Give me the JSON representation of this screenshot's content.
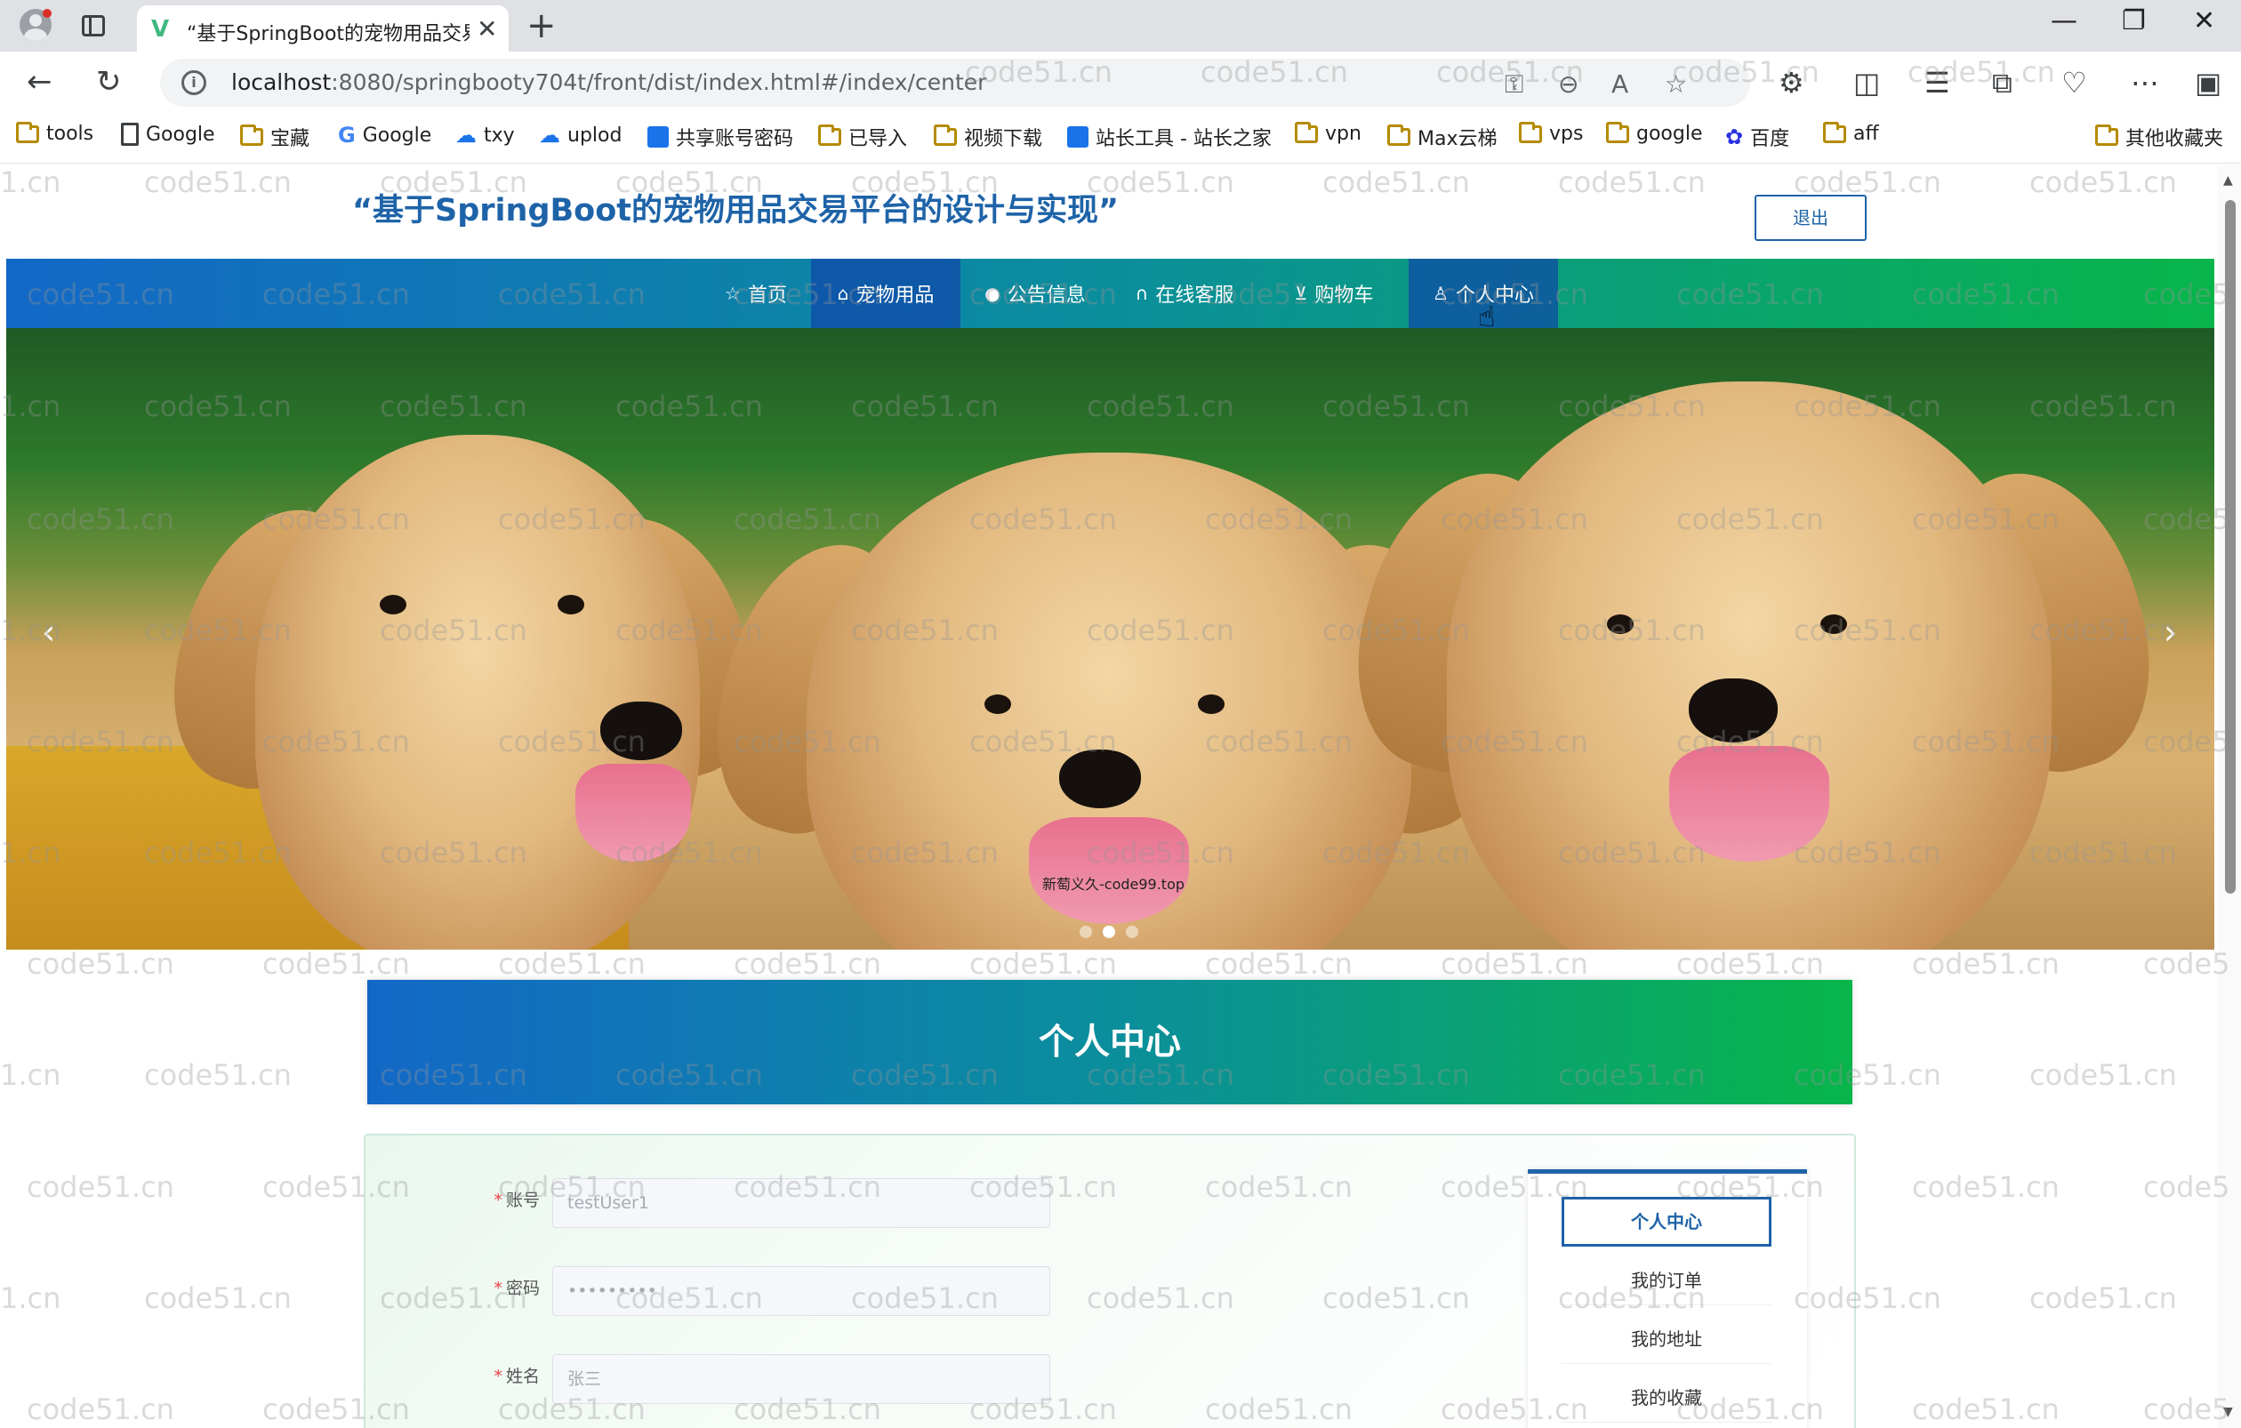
{
  "browser": {
    "tab_title": "“基于SpringBoot的宠物用品交易平台的设计与实现”",
    "tab_favicon": "V",
    "url_host": "localhost",
    "url_rest": ":8080/springbooty704t/front/dist/index.html#/index/center",
    "icons": [
      "back-icon",
      "refresh-icon",
      "key-icon",
      "zoom-out-icon",
      "read-aloud-icon",
      "star-icon",
      "extensions-icon",
      "split-screen-icon",
      "favorites-icon",
      "collections-icon",
      "performance-icon",
      "more-icon",
      "sidebar-icon"
    ]
  },
  "bookmarks": [
    {
      "label": "tools",
      "icon": "folder"
    },
    {
      "label": "Google",
      "icon": "page"
    },
    {
      "label": "宝藏",
      "icon": "folder"
    },
    {
      "label": "Google",
      "icon": "google"
    },
    {
      "label": "txy",
      "icon": "cloud"
    },
    {
      "label": "uplod",
      "icon": "cloud"
    },
    {
      "label": "共享账号密码",
      "icon": "app"
    },
    {
      "label": "已导入",
      "icon": "folder"
    },
    {
      "label": "视频下载",
      "icon": "folder"
    },
    {
      "label": "站长工具 - 站长之家",
      "icon": "app"
    },
    {
      "label": "vpn",
      "icon": "folder"
    },
    {
      "label": "Max云梯",
      "icon": "folder"
    },
    {
      "label": "vps",
      "icon": "folder"
    },
    {
      "label": "google",
      "icon": "folder"
    },
    {
      "label": "百度",
      "icon": "baidu"
    },
    {
      "label": "aff",
      "icon": "folder"
    }
  ],
  "bookmarks_other": "其他收藏夹",
  "site": {
    "title": "“基于SpringBoot的宠物用品交易平台的设计与实现”",
    "logout": "退出"
  },
  "nav": [
    {
      "label": "首页",
      "icon": "star-outline-icon"
    },
    {
      "label": "宠物用品",
      "icon": "bag-icon"
    },
    {
      "label": "公告信息",
      "icon": "info-circle-icon"
    },
    {
      "label": "在线客服",
      "icon": "headset-icon"
    },
    {
      "label": "购物车",
      "icon": "cart-icon"
    },
    {
      "label": "个人中心",
      "icon": "user-icon",
      "active": true
    }
  ],
  "banner": {
    "watermark_text": "新萄义久-code99.top",
    "slide_count": 3,
    "active_slide": 2
  },
  "section": {
    "title": "个人中心"
  },
  "form": {
    "fields": [
      {
        "label": "账号",
        "value": "testUser1"
      },
      {
        "label": "密码",
        "value": "•••••••••"
      },
      {
        "label": "姓名",
        "value": "张三"
      }
    ]
  },
  "side_menu": [
    {
      "label": "个人中心",
      "active": true
    },
    {
      "label": "我的订单"
    },
    {
      "label": "我的地址"
    },
    {
      "label": "我的收藏"
    }
  ],
  "watermark": "code51.cn",
  "watermark_partial": "1.cn",
  "watermark_edge": "code5"
}
